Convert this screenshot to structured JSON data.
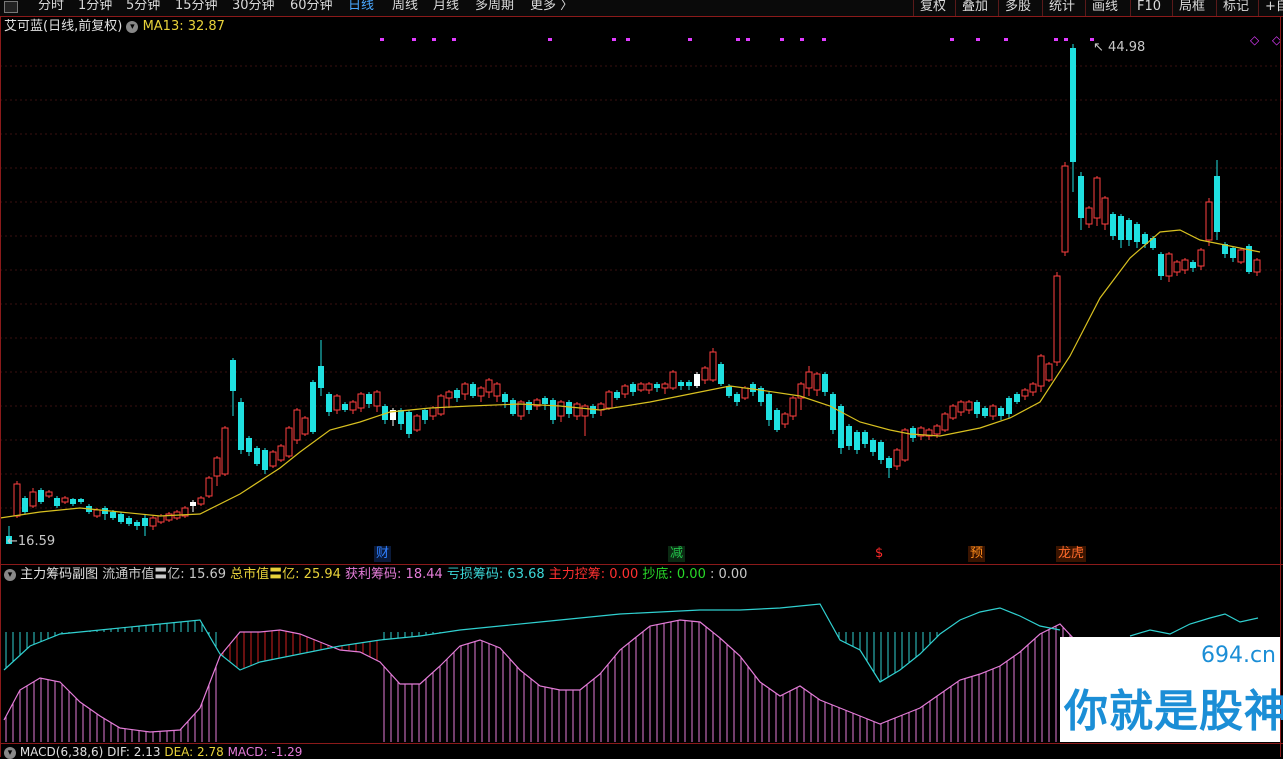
{
  "toolbar": {
    "periods": [
      "分时",
      "1分钟",
      "5分钟",
      "15分钟",
      "30分钟",
      "60分钟",
      "日线",
      "周线",
      "月线",
      "多周期",
      "更多 〉"
    ],
    "active_period": "日线",
    "right_buttons": [
      "复权",
      "叠加",
      "多股",
      "统计",
      "画线",
      "F10",
      "局框",
      "标记",
      "+自"
    ]
  },
  "main": {
    "title": "艾可蓝(日线,前复权)",
    "ma_label": "MA13: 32.87",
    "max_label": "44.98",
    "min_label": "16.59",
    "events": [
      {
        "label": "财",
        "color": "#2f7fff"
      },
      {
        "label": "减",
        "color": "#24c24a"
      },
      {
        "label": "$",
        "color": "#ff2a2a"
      },
      {
        "label": "预",
        "color": "#ff8c1a"
      },
      {
        "label": "龙虎",
        "color": "#ff6a2a"
      }
    ]
  },
  "sub": {
    "name": "主力筹码副图",
    "items": [
      {
        "label": "流通市值〓亿: 15.69",
        "color": "#c8c8c8"
      },
      {
        "label": "总市值〓亿: 25.94",
        "color": "#e8d23a"
      },
      {
        "label": "获利筹码: 18.44",
        "color": "#e47cd8"
      },
      {
        "label": "亏损筹码: 63.68",
        "color": "#3cd8d8"
      },
      {
        "label": "主力控筹: 0.00",
        "color": "#ff3030"
      },
      {
        "label": "抄底: 0.00",
        "color": "#28d828"
      },
      {
        "label": ": 0.00",
        "color": "#c8c8c8"
      }
    ]
  },
  "macd": {
    "name": "MACD(6,38,6)",
    "dif": "DIF: 2.13",
    "dea": "DEA: 2.78",
    "macd": "MACD: -1.29"
  },
  "watermark": {
    "url": "694.cn",
    "text": "你就是股神"
  },
  "colors": {
    "up": "#ff4040",
    "down": "#1fe0e0",
    "ma": "#d8c020",
    "pink": "#e47cd8",
    "teal": "#30d0d0",
    "grid": "#8b1a1a"
  },
  "chart_data": {
    "type": "candlestick",
    "price_max": 44.98,
    "price_min": 16.59,
    "ma": "MA13",
    "ma_value": 32.87
  }
}
